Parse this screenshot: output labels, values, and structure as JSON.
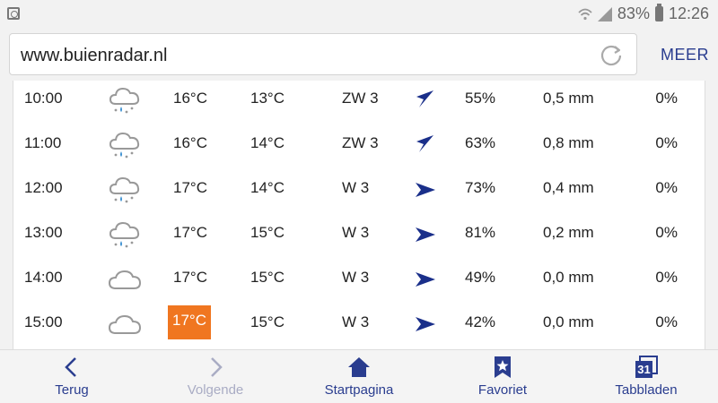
{
  "status": {
    "battery": "83%",
    "time": "12:26"
  },
  "browser": {
    "url": "www.buienradar.nl",
    "more": "MEER"
  },
  "rows": [
    {
      "time": "10:00",
      "icon": "cloud-rain-icon",
      "temp": "16°C",
      "feel": "13°C",
      "wind": "ZW 3",
      "dir": "arrow-northeast-icon",
      "humidity": "55%",
      "rain": "0,5 mm",
      "chance": "0%",
      "highlight": false
    },
    {
      "time": "11:00",
      "icon": "cloud-rain-icon",
      "temp": "16°C",
      "feel": "14°C",
      "wind": "ZW 3",
      "dir": "arrow-northeast-icon",
      "humidity": "63%",
      "rain": "0,8 mm",
      "chance": "0%",
      "highlight": false
    },
    {
      "time": "12:00",
      "icon": "cloud-rain-icon",
      "temp": "17°C",
      "feel": "14°C",
      "wind": "W 3",
      "dir": "arrow-east-icon",
      "humidity": "73%",
      "rain": "0,4 mm",
      "chance": "0%",
      "highlight": false
    },
    {
      "time": "13:00",
      "icon": "cloud-rain-icon",
      "temp": "17°C",
      "feel": "15°C",
      "wind": "W 3",
      "dir": "arrow-east-icon",
      "humidity": "81%",
      "rain": "0,2 mm",
      "chance": "0%",
      "highlight": false
    },
    {
      "time": "14:00",
      "icon": "cloud-icon",
      "temp": "17°C",
      "feel": "15°C",
      "wind": "W 3",
      "dir": "arrow-east-icon",
      "humidity": "49%",
      "rain": "0,0 mm",
      "chance": "0%",
      "highlight": false
    },
    {
      "time": "15:00",
      "icon": "cloud-icon",
      "temp": "17°C",
      "feel": "15°C",
      "wind": "W 3",
      "dir": "arrow-east-icon",
      "humidity": "42%",
      "rain": "0,0 mm",
      "chance": "0%",
      "highlight": true
    }
  ],
  "nav": [
    {
      "label": "Terug",
      "icon": "chevron-left-icon",
      "enabled": true
    },
    {
      "label": "Volgende",
      "icon": "chevron-right-icon",
      "enabled": false
    },
    {
      "label": "Startpagina",
      "icon": "home-icon",
      "enabled": true
    },
    {
      "label": "Favoriet",
      "icon": "bookmark-star-icon",
      "enabled": true
    },
    {
      "label": "Tabbladen",
      "icon": "tabs-icon",
      "enabled": true,
      "badge": "31"
    }
  ],
  "colors": {
    "accent": "#2a3d8f",
    "highlight": "#f07620"
  }
}
